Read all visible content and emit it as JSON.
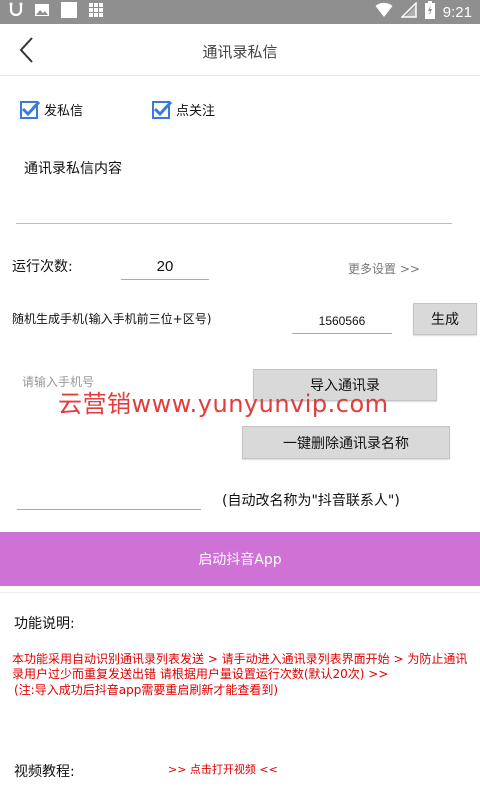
{
  "status_bar": {
    "time": "9:21",
    "left_icons": [
      "notification-icon",
      "image-icon",
      "square-icon",
      "grid-icon"
    ],
    "right_icons": [
      "wifi-icon",
      "signal-icon",
      "battery-icon"
    ]
  },
  "header": {
    "title": "通讯录私信",
    "back_icon": "chevron-left-icon"
  },
  "options": {
    "send_dm": {
      "label": "发私信",
      "checked": true
    },
    "follow": {
      "label": "点关注",
      "checked": true
    }
  },
  "message": {
    "label": "通讯录私信内容",
    "value": ""
  },
  "run": {
    "label": "运行次数:",
    "value": "20",
    "more_settings": "更多设置 >>"
  },
  "generator": {
    "label": "随机生成手机(输入手机前三位+区号)",
    "prefix_value": "1560566",
    "generate_button": "生成"
  },
  "phone": {
    "placeholder": "请输入手机号",
    "import_button": "导入通讯录",
    "delete_button": "一键删除通讯录名称"
  },
  "rename": {
    "value": "",
    "note": "(自动改名称为\"抖音联系人\")"
  },
  "watermark": "云营销www.yunyunvip.com",
  "launch_button": "启动抖音App",
  "description": {
    "label": "功能说明:",
    "line1": "本功能采用自动识别通讯录列表发送 > 请手动进入通讯录列表界面开始 > 为防止通讯录用户过少而重复发送出错 请根据用户量设置运行次数(默认20次) >>",
    "line2": "(注:导入成功后抖音app需要重启刷新才能查看到)"
  },
  "video": {
    "label": "视频教程:",
    "link": ">> 点击打开视频 <<"
  },
  "colors": {
    "status_bar": "#8f8f8f",
    "checkbox": "#3a7bd5",
    "launch_button": "#ce72d6",
    "red_text": "#e00000",
    "watermark": "#e43b3b"
  }
}
